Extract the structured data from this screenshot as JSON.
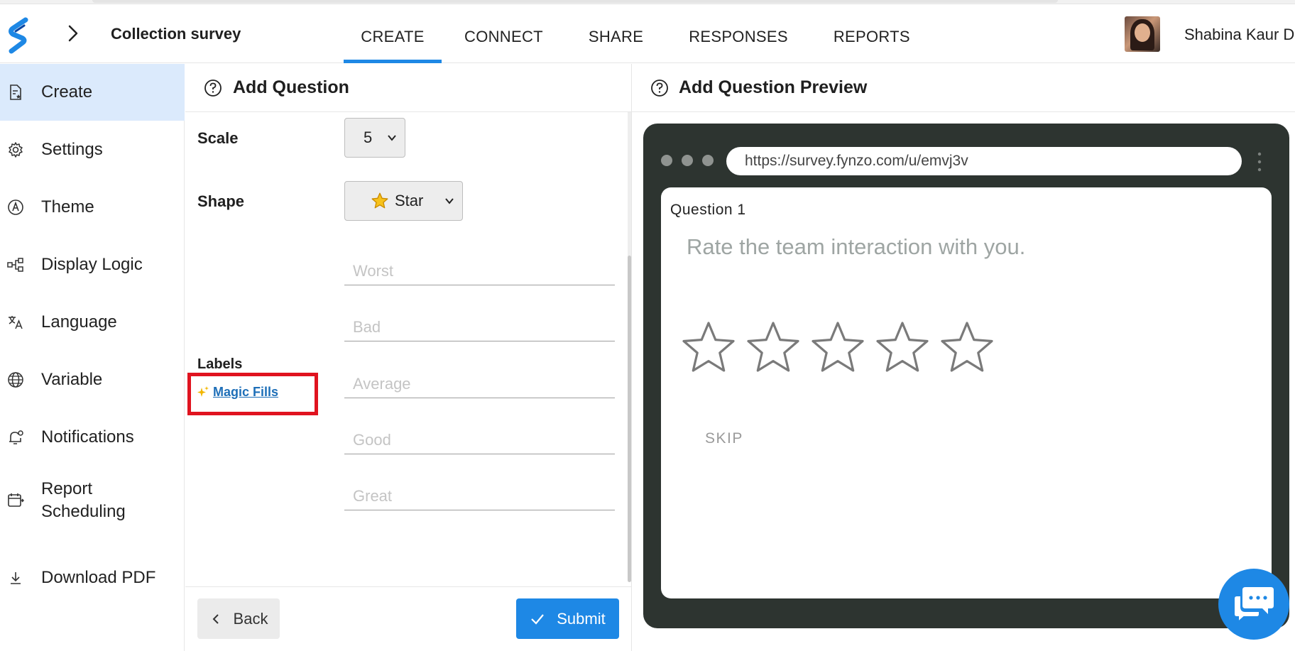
{
  "header": {
    "survey_title": "Collection survey",
    "tabs": [
      {
        "label": "CREATE",
        "active": true
      },
      {
        "label": "CONNECT"
      },
      {
        "label": "SHARE"
      },
      {
        "label": "RESPONSES"
      },
      {
        "label": "REPORTS"
      }
    ],
    "user_name": "Shabina Kaur D"
  },
  "sidebar": {
    "items": [
      {
        "label": "Create",
        "icon": "create-form-icon",
        "active": true
      },
      {
        "label": "Settings",
        "icon": "gear-icon"
      },
      {
        "label": "Theme",
        "icon": "theme-icon"
      },
      {
        "label": "Display Logic",
        "icon": "logic-flow-icon"
      },
      {
        "label": "Language",
        "icon": "translate-icon"
      },
      {
        "label": "Variable",
        "icon": "globe-icon"
      },
      {
        "label": "Notifications",
        "icon": "bell-icon"
      },
      {
        "label": "Report Scheduling",
        "icon": "calendar-icon"
      },
      {
        "label": "Download PDF",
        "icon": "download-icon"
      }
    ]
  },
  "editor": {
    "title": "Add Question",
    "scale_label": "Scale",
    "scale_value": "5",
    "shape_label": "Shape",
    "shape_value": "Star",
    "labels_label": "Labels",
    "magic_fills": "Magic Fills",
    "label_placeholders": [
      "Worst",
      "Bad",
      "Average",
      "Good",
      "Great"
    ],
    "back_label": "Back",
    "submit_label": "Submit"
  },
  "preview": {
    "title": "Add Question Preview",
    "url": "https://survey.fynzo.com/u/emvj3v",
    "question_number": "Question 1",
    "question_text": "Rate the team interaction with you.",
    "star_count": 5,
    "skip_label": "SKIP"
  },
  "colors": {
    "accent": "#1e88e5",
    "sidebar_active_bg": "#dbeafc",
    "device_frame": "#2d3430",
    "highlight_box": "#e0131f"
  }
}
